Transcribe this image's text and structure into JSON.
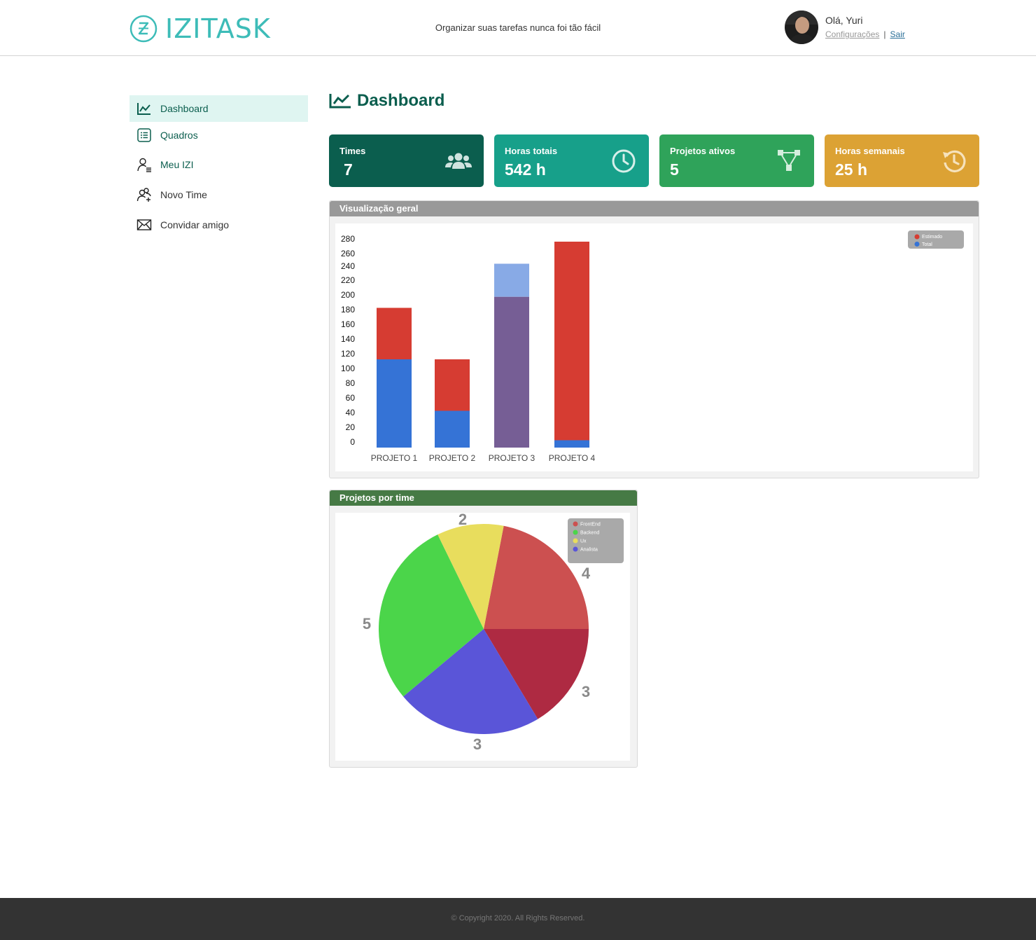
{
  "header": {
    "brand": "IZITASK",
    "tagline": "Organizar suas tarefas nunca foi tão fácil",
    "greeting": "Olá, Yuri",
    "settings_link": "Configurações",
    "separator": "|",
    "logout_link": "Sair"
  },
  "sidebar": {
    "items": [
      {
        "label": "Dashboard",
        "icon": "chart-line-icon"
      },
      {
        "label": "Quadros",
        "icon": "list-icon"
      },
      {
        "label": "Meu IZI",
        "icon": "user-list-icon"
      },
      {
        "label": "Novo Time",
        "icon": "users-add-icon"
      },
      {
        "label": "Convidar amigo",
        "icon": "envelope-icon"
      }
    ]
  },
  "page": {
    "title": "Dashboard"
  },
  "cards": [
    {
      "label": "Times",
      "value": "7",
      "icon": "users-icon",
      "color": "#0b5e4e"
    },
    {
      "label": "Horas totais",
      "value": "542 h",
      "icon": "clock-icon",
      "color": "#17a08a"
    },
    {
      "label": "Projetos ativos",
      "value": "5",
      "icon": "sitemap-icon",
      "color": "#2fa35a"
    },
    {
      "label": "Horas semanais",
      "value": "25 h",
      "icon": "history-icon",
      "color": "#dca234"
    }
  ],
  "panels": {
    "overview_title": "Visualização geral",
    "teams_title": "Projetos por time"
  },
  "chart_data": [
    {
      "type": "bar",
      "stacked": true,
      "categories": [
        "PROJETO 1",
        "PROJETO 2",
        "PROJETO 3",
        "PROJETO 4"
      ],
      "series": [
        {
          "name": "Total",
          "values": [
            120,
            50,
            250,
            10
          ],
          "color": "#3573d6"
        },
        {
          "name": "Estimado",
          "values": [
            190,
            120,
            205,
            280
          ],
          "color": "#d63c32"
        }
      ],
      "yticks": [
        "0",
        "20",
        "40",
        "60",
        "80",
        "100",
        "120",
        "140",
        "160",
        "180",
        "200",
        "220",
        "240",
        "260",
        "280"
      ],
      "ylim": [
        0,
        280
      ],
      "legend": "top-right",
      "overlap_colors": {
        "estimado_over_total": "#88aae6",
        "total_over_estimado": "#765e95"
      }
    },
    {
      "type": "pie",
      "categories": [
        "FrontEnd",
        "Backend",
        "Ux",
        "Analista"
      ],
      "slices": [
        {
          "name": "FrontEnd",
          "values": [
            4,
            3
          ],
          "colors": [
            "#cc5050",
            "#ae2a42"
          ]
        },
        {
          "name": "Analista",
          "value": 3,
          "color": "#5a55d8"
        },
        {
          "name": "Backend",
          "value": 5,
          "color": "#4bd54a"
        },
        {
          "name": "Ux",
          "value": 2,
          "color": "#e8dd5d"
        }
      ],
      "labels": [
        "4",
        "3",
        "3",
        "5",
        "2"
      ],
      "legend_colors": [
        "#cc5050",
        "#4bd54a",
        "#e8dd5d",
        "#5a55d8"
      ],
      "legend": "top-right"
    }
  ],
  "footer": {
    "copyright": "© Copyright 2020. All Rights Reserved."
  }
}
